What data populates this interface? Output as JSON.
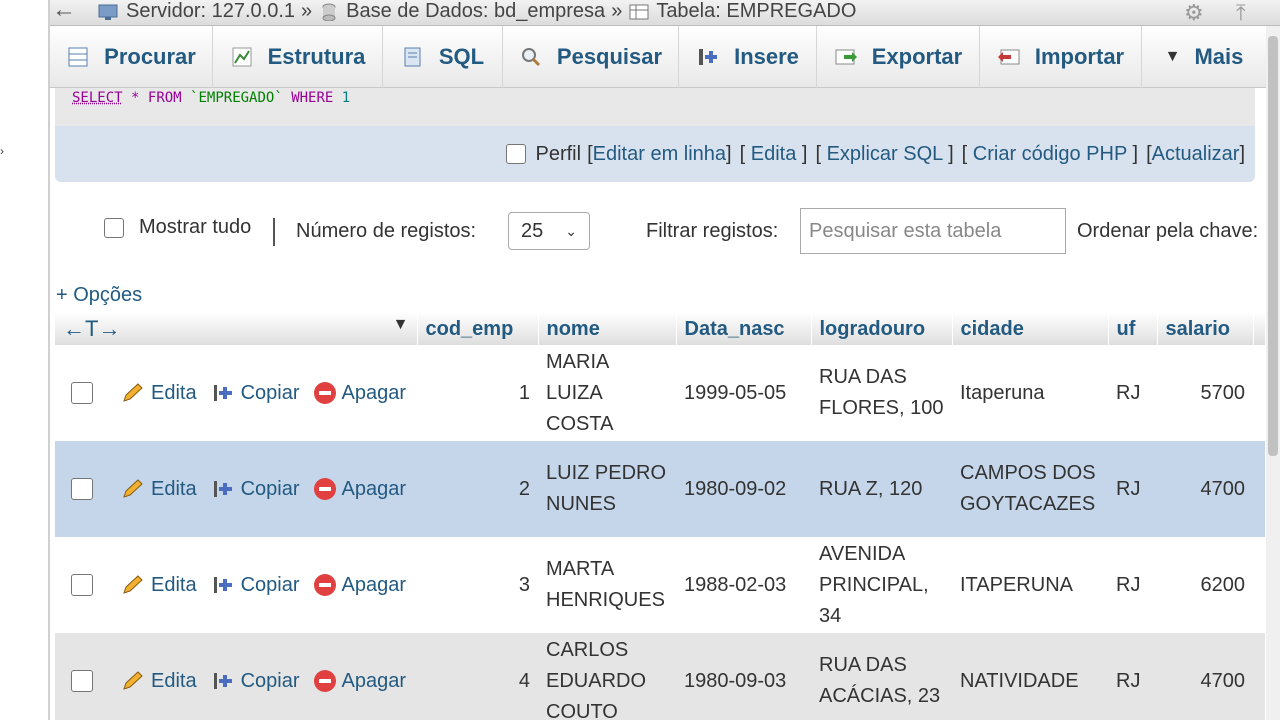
{
  "breadcrumb": {
    "server": "Servidor: 127.0.0.1",
    "database": "Base de Dados: bd_empresa",
    "table": "Tabela: EMPREGADO",
    "separator": "»"
  },
  "tabs": [
    {
      "label": "Procurar",
      "icon": "browse-icon"
    },
    {
      "label": "Estrutura",
      "icon": "structure-icon"
    },
    {
      "label": "SQL",
      "icon": "sql-icon"
    },
    {
      "label": "Pesquisar",
      "icon": "search-icon"
    },
    {
      "label": "Insere",
      "icon": "insert-icon"
    },
    {
      "label": "Exportar",
      "icon": "export-icon"
    },
    {
      "label": "Importar",
      "icon": "import-icon"
    },
    {
      "label": "Mais",
      "icon": "caret-down-icon"
    }
  ],
  "sql": {
    "select": "SELECT",
    "star": "*",
    "from": "FROM",
    "table": "`EMPREGADO`",
    "where": "WHERE",
    "value": "1"
  },
  "profile": {
    "perfil": "Perfil",
    "edit_inline": "Editar em linha",
    "edit": "Edita",
    "explain": "Explicar SQL",
    "php": "Criar código PHP",
    "refresh": "Actualizar"
  },
  "controls": {
    "show_all": "Mostrar tudo",
    "num_records_label": "Número de registos:",
    "num_records_value": "25",
    "filter_label": "Filtrar registos:",
    "filter_placeholder": "Pesquisar esta tabela",
    "sort_label": "Ordenar pela chave:"
  },
  "options_link": "+ Opções",
  "table": {
    "columns": [
      "cod_emp",
      "nome",
      "Data_nasc",
      "logradouro",
      "cidade",
      "uf",
      "salario"
    ],
    "actions": {
      "edit": "Edita",
      "copy": "Copiar",
      "delete": "Apagar"
    },
    "rows": [
      {
        "cod_emp": "1",
        "nome": "MARIA LUIZA COSTA",
        "data_nasc": "1999-05-05",
        "logradouro": "RUA DAS FLORES, 100",
        "cidade": "Itaperuna",
        "uf": "RJ",
        "salario": "5700"
      },
      {
        "cod_emp": "2",
        "nome": "LUIZ PEDRO NUNES",
        "data_nasc": "1980-09-02",
        "logradouro": "RUA Z, 120",
        "cidade": "CAMPOS DOS GOYTACAZES",
        "uf": "RJ",
        "salario": "4700"
      },
      {
        "cod_emp": "3",
        "nome": "MARTA HENRIQUES",
        "data_nasc": "1988-02-03",
        "logradouro": "AVENIDA PRINCIPAL, 34",
        "cidade": "ITAPERUNA",
        "uf": "RJ",
        "salario": "6200"
      },
      {
        "cod_emp": "4",
        "nome": "CARLOS EDUARDO COUTO",
        "data_nasc": "1980-09-03",
        "logradouro": "RUA DAS ACÁCIAS, 23",
        "cidade": "NATIVIDADE",
        "uf": "RJ",
        "salario": "4700"
      }
    ]
  }
}
